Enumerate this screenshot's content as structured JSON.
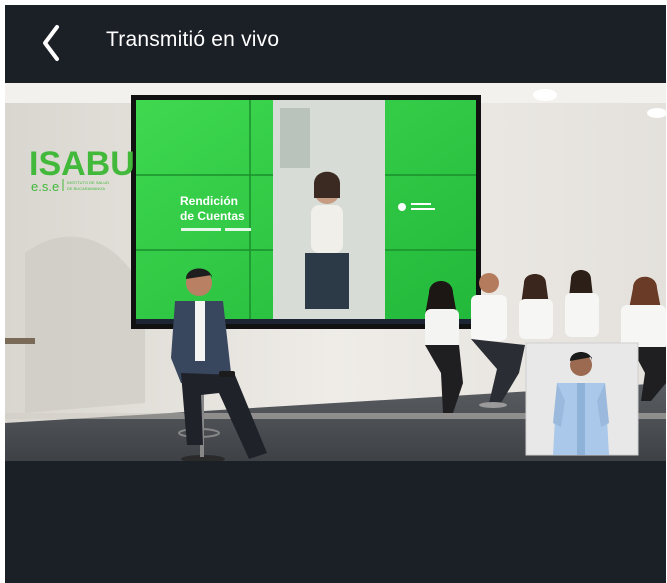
{
  "header": {
    "title": "Transmitió en vivo",
    "back_icon": "chevron-left-icon"
  },
  "video": {
    "brand": {
      "name": "ISABU",
      "sub": "e.s.e",
      "tagline_1": "INSTITUTO DE SALUD",
      "tagline_2": "DE BUCARAMANGA"
    },
    "screen": {
      "heading_1": "Rendición",
      "heading_2": "de Cuentas"
    },
    "interpreter_inset": "sign-language-interpreter",
    "colors": {
      "brand_green": "#3dc13a",
      "screen_green": "#2fcf4a",
      "background": "#1b1f26"
    }
  }
}
